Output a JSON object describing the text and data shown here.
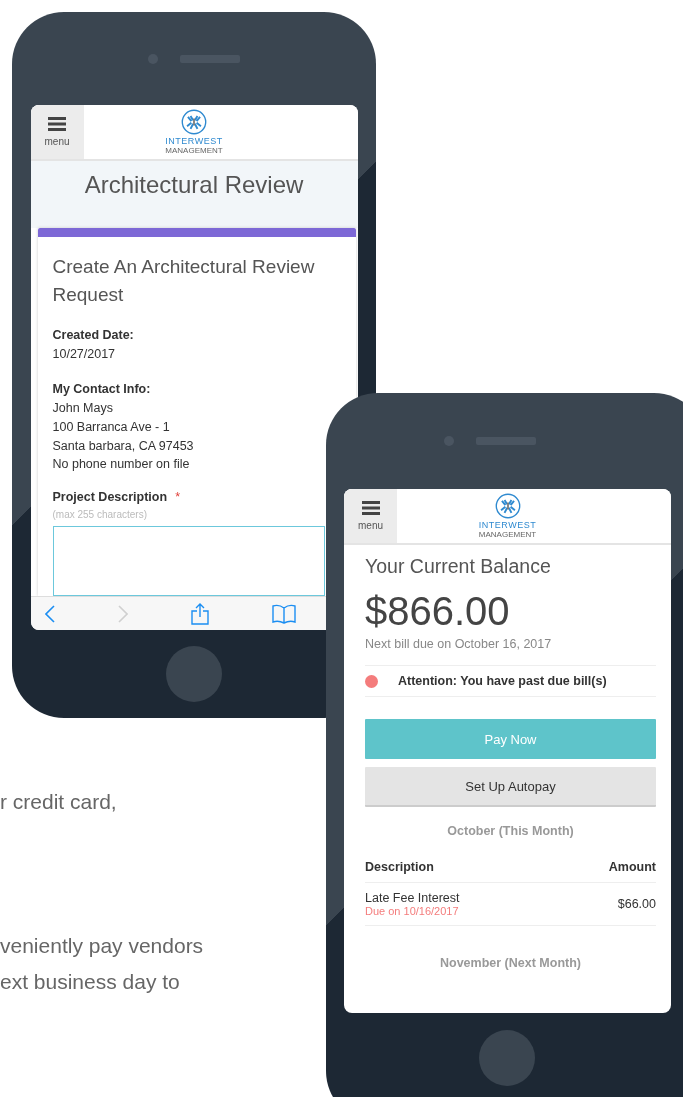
{
  "background_text": [
    "r credit card,",
    "veniently pay vendors",
    "ext business day to"
  ],
  "review_phone": {
    "header": {
      "menu_label": "menu",
      "logo_title": "INTERWEST",
      "logo_subtitle": "MANAGEMENT"
    },
    "page_title": "Architectural Review",
    "form_title": "Create An Architectural Review Request",
    "info": [
      {
        "label": "Created Date:",
        "lines": [
          "10/27/2017"
        ]
      },
      {
        "label": "My Contact Info:",
        "lines": [
          "John Mays",
          "100 Barranca Ave - 1",
          "Santa barbara, CA 97453",
          "No phone number on file"
        ]
      }
    ],
    "project_description": {
      "label": "Project Description",
      "required_mark": "*",
      "hint": "(max 255 characters)"
    },
    "browser_toolbar": {
      "back_disabled": false,
      "forward_disabled": true
    }
  },
  "balance_phone": {
    "header": {
      "menu_label": "menu",
      "logo_title": "INTERWEST",
      "logo_subtitle": "MANAGEMENT"
    },
    "title": "Your Current Balance",
    "amount": "$866.00",
    "next_bill": "Next bill due on October 16, 2017",
    "alert": "Attention: You have past due bill(s)",
    "buttons": [
      {
        "label": "Pay Now",
        "kind": "primary"
      },
      {
        "label": "Set Up Autopay",
        "kind": "secondary"
      }
    ],
    "months": [
      {
        "title": "October (This Month)",
        "columns": [
          "Description",
          "Amount"
        ],
        "rows": [
          {
            "description": "Late Fee Interest",
            "due": "Due on 10/16/2017",
            "amount": "$66.00"
          }
        ]
      },
      {
        "title": "November (Next Month)"
      }
    ]
  }
}
